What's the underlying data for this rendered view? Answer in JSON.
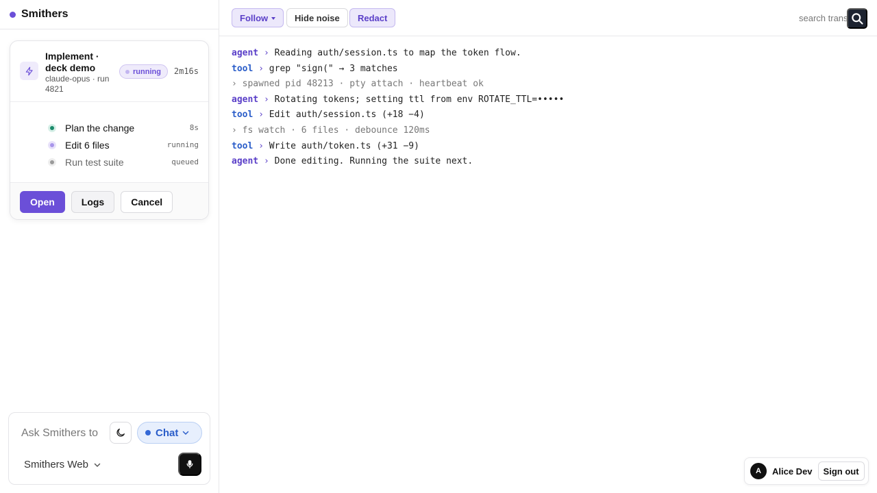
{
  "app": {
    "name": "Smithers"
  },
  "task": {
    "title": "Implement · deck demo",
    "meta": "claude-opus · run 4821",
    "status": "running",
    "elapsed": "2m16s",
    "steps": [
      {
        "label": "Plan the change",
        "state": "8s",
        "status": "done"
      },
      {
        "label": "Edit 6 files",
        "state": "running",
        "status": "running"
      },
      {
        "label": "Run test suite",
        "state": "queued",
        "status": "queued"
      }
    ],
    "actions": {
      "open": "Open",
      "logs": "Logs",
      "cancel": "Cancel"
    }
  },
  "composer": {
    "placeholder": "Ask Smithers to",
    "mode": "Chat",
    "workspace": "Smithers Web"
  },
  "toolbar": {
    "follow": "Follow",
    "hide_noise": "Hide noise",
    "redact": "Redact",
    "search_placeholder": "search transcript"
  },
  "transcript": [
    {
      "speaker": "agent",
      "text": "Reading auth/session.ts to map the token flow."
    },
    {
      "speaker": "tool",
      "text": "grep \"sign(\" → 3 matches"
    },
    {
      "speaker": "",
      "text": "spawned pid 48213 · pty attach · heartbeat ok"
    },
    {
      "speaker": "agent",
      "text": "Rotating tokens; setting ttl from env ROTATE_TTL=•••••"
    },
    {
      "speaker": "tool",
      "text": "Edit auth/session.ts (+18 −4)"
    },
    {
      "speaker": "",
      "text": "fs watch · 6 files · debounce 120ms"
    },
    {
      "speaker": "tool",
      "text": "Write auth/token.ts (+31 −9)"
    },
    {
      "speaker": "agent",
      "text": "Done editing. Running the suite next."
    }
  ],
  "transcript_separator": "›",
  "user": {
    "initial": "A",
    "name": "Alice Dev",
    "signout": "Sign out"
  },
  "colors": {
    "accent": "#6b4fd8",
    "tool": "#2a5dc9",
    "noise": "#777777"
  },
  "icons": {
    "task": "lightning-icon",
    "theme": "moon-icon",
    "mode_caret": "chevron-down-icon",
    "mic": "microphone-icon",
    "search": "search-icon"
  }
}
